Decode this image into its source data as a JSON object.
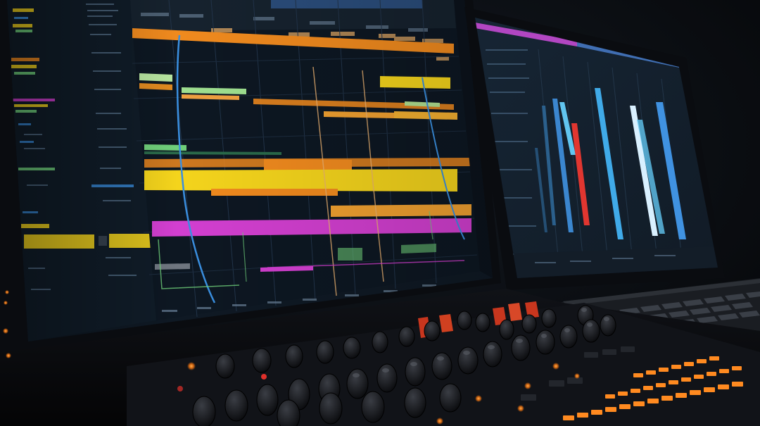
{
  "scene": {
    "description_tags": [
      "dual-monitor",
      "audio-workstation",
      "mixing-console",
      "keyboard"
    ]
  },
  "colors": {
    "background": "#07080b",
    "screen_dark": "#0d1722",
    "grid": "#22344a",
    "yellow": "#f4d41c",
    "orange": "#f08a1e",
    "magenta": "#d23fd0",
    "blue": "#3a8fe0",
    "cyan": "#5cc4f0",
    "green": "#6fcf7a",
    "red": "#e0302a",
    "knob_led": "#ff8a20"
  },
  "icons": {
    "knobs": "rotary-knob-icon",
    "faders": "fader-icon"
  }
}
